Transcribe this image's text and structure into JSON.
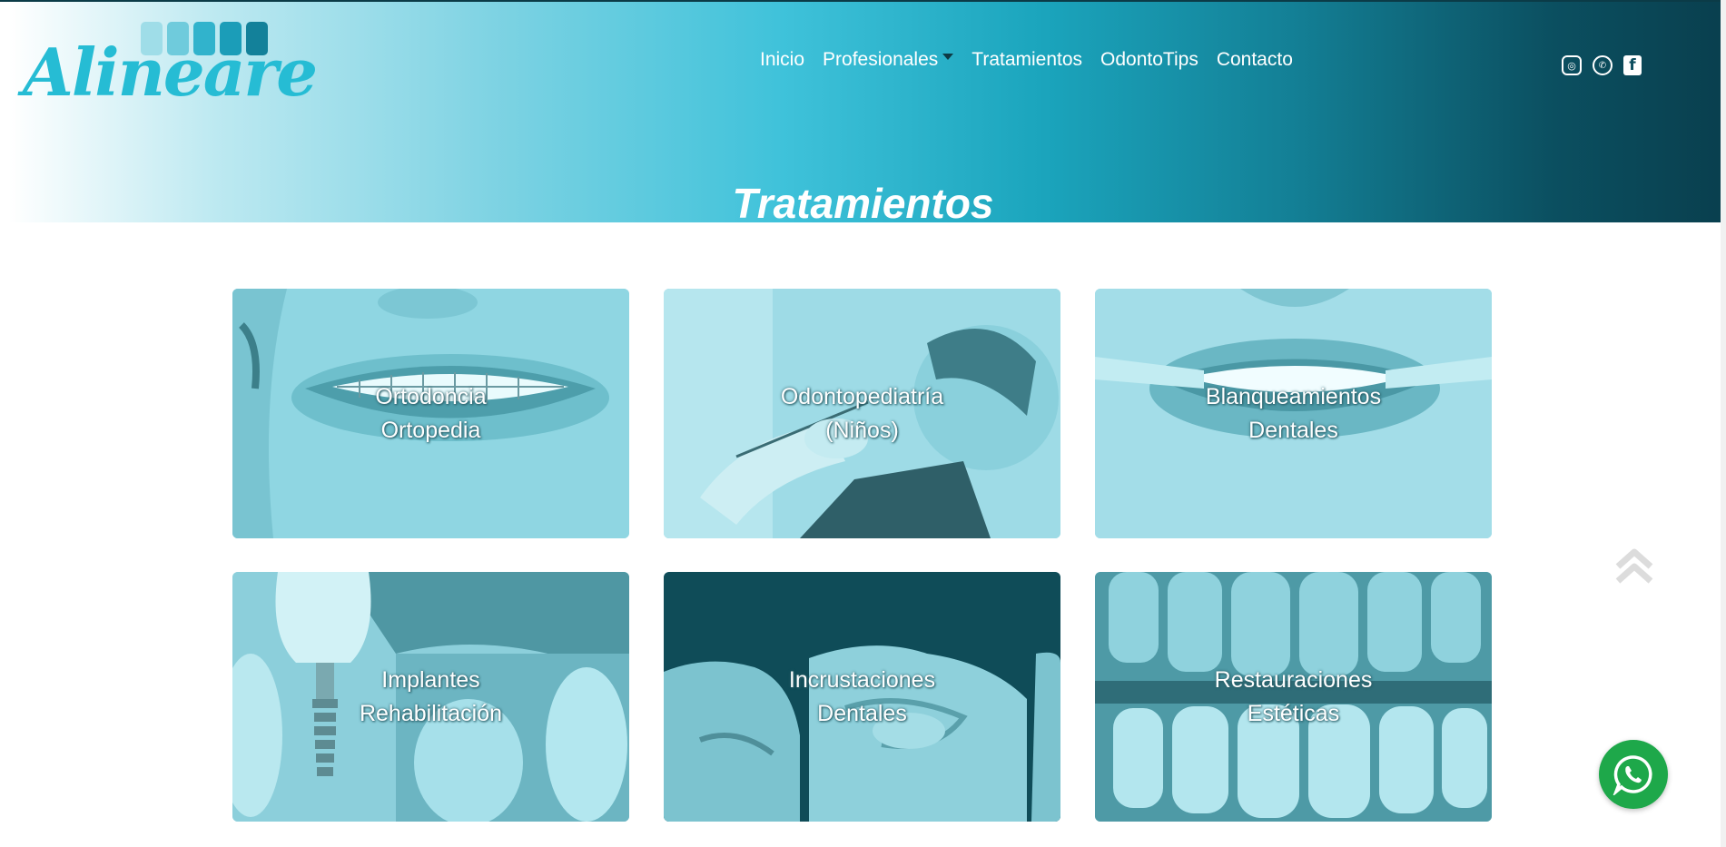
{
  "brand": {
    "name": "Alineare",
    "colors": {
      "accent": "#26bcd4",
      "dark": "#093f4e",
      "whatsapp": "#1ea84a",
      "teeth": [
        "#9fdde8",
        "#6fcbdc",
        "#31b3cc",
        "#1b9db8",
        "#13819a"
      ]
    }
  },
  "nav": {
    "items": [
      {
        "label": "Inicio"
      },
      {
        "label": "Profesionales",
        "dropdown": true
      },
      {
        "label": "Tratamientos"
      },
      {
        "label": "OdontoTips"
      },
      {
        "label": "Contacto"
      }
    ]
  },
  "social": {
    "icons": [
      "instagram-icon",
      "whatsapp-icon",
      "facebook-icon"
    ],
    "instagram": "◎",
    "whatsapp": "✆",
    "facebook": "f"
  },
  "page": {
    "title": "Tratamientos"
  },
  "treatments": [
    {
      "label": "Ortodoncia\nOrtopedia",
      "image": "smile-with-braces"
    },
    {
      "label": "Odontopediatría\n(Niños)",
      "image": "child-dental-checkup"
    },
    {
      "label": "Blanqueamientos\nDentales",
      "image": "white-smile"
    },
    {
      "label": "Implantes\nRehabilitación",
      "image": "dental-implant"
    },
    {
      "label": "Incrustaciones\nDentales",
      "image": "molar-teeth"
    },
    {
      "label": "Restauraciones\nEstéticas",
      "image": "aesthetic-teeth"
    }
  ],
  "widgets": {
    "scroll_top_icon": "double-chevron-up-icon",
    "whatsapp_float_icon": "whatsapp-icon"
  }
}
